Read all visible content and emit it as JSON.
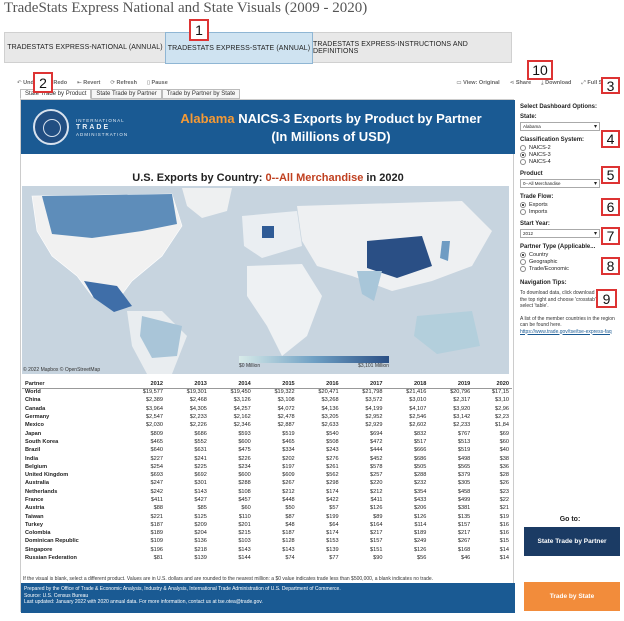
{
  "page_title": "TradeStats Express National and State Visuals (2009 - 2020)",
  "tabs": [
    "TRADESTATS EXPRESS-NATIONAL (ANNUAL)",
    "TRADESTATS EXPRESS-STATE (ANNUAL)",
    "TRADESTATS EXPRESS-INSTRUCTIONS AND DEFINITIONS"
  ],
  "callouts": [
    "1",
    "2",
    "3",
    "4",
    "5",
    "6",
    "7",
    "8",
    "9",
    "10"
  ],
  "toolbar": {
    "undo": "Undo",
    "redo": "Redo",
    "revert": "Revert",
    "refresh": "Refresh",
    "pause": "Pause",
    "view_original": "View: Original",
    "share": "Share",
    "download": "Download",
    "full_screen": "Full Screen"
  },
  "subtabs": [
    "State Trade by Product",
    "State Trade by Partner",
    "Trade by Partner by State"
  ],
  "banner": {
    "org_small": "INTERNATIONAL",
    "org_big": "TRADE",
    "org_small2": "ADMINISTRATION",
    "state": "Alabama",
    "title_rest": "NAICS-3 Exports by Product by Partner",
    "subtitle": "(In Millions of USD)"
  },
  "map": {
    "title_pre": "U.S. Exports by Country: ",
    "title_product": "0--All Merchandise",
    "title_post": " in 2020",
    "legend_low": "$0 Million",
    "legend_high": "$3,101 Million",
    "credit": "© 2022 Mapbox  © OpenStreetMap"
  },
  "table": {
    "headers": [
      "Partner",
      "2012",
      "2013",
      "2014",
      "2015",
      "2016",
      "2017",
      "2018",
      "2019",
      "2020"
    ],
    "rows": [
      [
        "World",
        "$19,577",
        "$19,301",
        "$19,450",
        "$19,322",
        "$20,471",
        "$21,798",
        "$21,416",
        "$20,796",
        "$17,15"
      ],
      [
        "China",
        "$2,389",
        "$2,468",
        "$3,126",
        "$3,108",
        "$3,268",
        "$3,572",
        "$3,010",
        "$2,317",
        "$3,10"
      ],
      [
        "Canada",
        "$3,964",
        "$4,305",
        "$4,257",
        "$4,072",
        "$4,136",
        "$4,199",
        "$4,107",
        "$3,920",
        "$2,96"
      ],
      [
        "Germany",
        "$2,547",
        "$2,233",
        "$2,162",
        "$2,478",
        "$3,205",
        "$2,952",
        "$2,546",
        "$3,142",
        "$2,23"
      ],
      [
        "Mexico",
        "$2,030",
        "$2,226",
        "$2,346",
        "$2,887",
        "$2,633",
        "$2,929",
        "$2,602",
        "$2,233",
        "$1,84"
      ],
      [
        "Japan",
        "$809",
        "$686",
        "$593",
        "$519",
        "$540",
        "$694",
        "$832",
        "$767",
        "$69"
      ],
      [
        "South Korea",
        "$465",
        "$552",
        "$600",
        "$465",
        "$508",
        "$472",
        "$517",
        "$513",
        "$60"
      ],
      [
        "Brazil",
        "$640",
        "$631",
        "$475",
        "$334",
        "$243",
        "$444",
        "$666",
        "$519",
        "$40"
      ],
      [
        "India",
        "$227",
        "$241",
        "$226",
        "$202",
        "$276",
        "$452",
        "$686",
        "$498",
        "$38"
      ],
      [
        "Belgium",
        "$254",
        "$225",
        "$234",
        "$197",
        "$261",
        "$578",
        "$505",
        "$565",
        "$36"
      ],
      [
        "United Kingdom",
        "$693",
        "$692",
        "$600",
        "$609",
        "$562",
        "$257",
        "$288",
        "$379",
        "$28"
      ],
      [
        "Australia",
        "$247",
        "$301",
        "$288",
        "$267",
        "$298",
        "$220",
        "$232",
        "$305",
        "$26"
      ],
      [
        "Netherlands",
        "$242",
        "$143",
        "$108",
        "$212",
        "$174",
        "$212",
        "$354",
        "$458",
        "$23"
      ],
      [
        "France",
        "$411",
        "$427",
        "$457",
        "$448",
        "$422",
        "$411",
        "$433",
        "$499",
        "$22"
      ],
      [
        "Austria",
        "$88",
        "$85",
        "$60",
        "$50",
        "$57",
        "$126",
        "$206",
        "$381",
        "$21"
      ],
      [
        "Taiwan",
        "$221",
        "$125",
        "$110",
        "$87",
        "$199",
        "$89",
        "$126",
        "$135",
        "$19"
      ],
      [
        "Turkey",
        "$187",
        "$209",
        "$201",
        "$48",
        "$64",
        "$164",
        "$114",
        "$157",
        "$16"
      ],
      [
        "Colombia",
        "$189",
        "$204",
        "$215",
        "$187",
        "$174",
        "$217",
        "$189",
        "$217",
        "$16"
      ],
      [
        "Dominican Republic",
        "$109",
        "$136",
        "$103",
        "$128",
        "$153",
        "$157",
        "$249",
        "$267",
        "$15"
      ],
      [
        "Singapore",
        "$196",
        "$218",
        "$143",
        "$143",
        "$139",
        "$151",
        "$126",
        "$168",
        "$14"
      ],
      [
        "Russian Federation",
        "$81",
        "$139",
        "$144",
        "$74",
        "$77",
        "$90",
        "$56",
        "$46",
        "$14"
      ]
    ]
  },
  "footer": {
    "note": "If the visual is blank, select a different product. Values are in U.S. dollars and are rounded to the nearest million: a $0 value indicates trade less than $500,000, a blank indicates no trade.",
    "line1": "Prepared by the Office of Trade & Economic Analysis, Industry & Analysis, International Trade Administration of U.S. Department of Commerce.",
    "line2": "Source: U.S. Census Bureau",
    "line3": "Last updated: January 2022 with 2020 annual data. For more information, contact us at tse.otea@trade.gov."
  },
  "side": {
    "options_title": "Select Dashboard Options:",
    "state_label": "State:",
    "state_value": "Alabama",
    "class_label": "Classification System:",
    "class_options": [
      "NAICS-2",
      "NAICS-3",
      "NAICS-4"
    ],
    "class_selected": 1,
    "product_label": "Product",
    "product_value": "0--All Merchandise",
    "flow_label": "Trade Flow:",
    "flow_options": [
      "Exports",
      "Imports"
    ],
    "flow_selected": 0,
    "year_label": "Start Year:",
    "year_value": "2012",
    "ptype_label": "Partner Type (Applicable...",
    "ptype_options": [
      "Country",
      "Geographic",
      "Trade/Economic"
    ],
    "ptype_selected": 0,
    "nav_title": "Navigation Tips:",
    "nav_text1": "To download data, click download button on the top right and choose 'crosstab' then select 'table'.",
    "nav_text2": "A list of the member countries in the region can be found here.",
    "nav_link": "https://www.trade.gov/tse/tse-express-faq",
    "goto": "Go to:",
    "btn_partner": "State Trade by Partner",
    "btn_state": "Trade by State"
  },
  "colors": {
    "banner": "#1a5a93",
    "accent_orange": "#f59a35",
    "map_dark": "#2a4f85",
    "callout": "#dd3333"
  }
}
